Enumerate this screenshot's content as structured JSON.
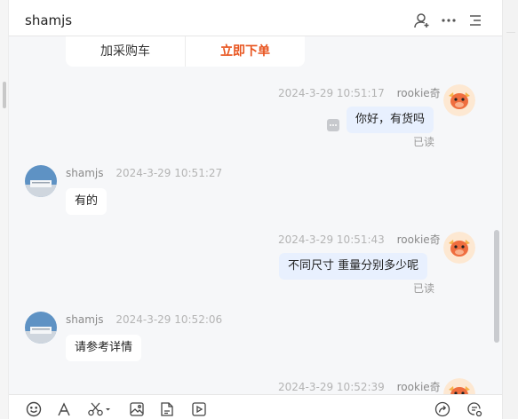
{
  "header": {
    "title": "shamjs",
    "icons": [
      "contact-icon",
      "more-icon",
      "list-icon"
    ]
  },
  "order_card": {
    "add_to_cart": "加采购车",
    "buy_now": "立即下单"
  },
  "messages": [
    {
      "sender": "rookie奇",
      "time": "2024-3-29 10:51:17",
      "text": "你好，有货吗",
      "status": "已读",
      "side": "right"
    },
    {
      "sender": "shamjs",
      "time": "2024-3-29 10:51:27",
      "text": "有的",
      "side": "left"
    },
    {
      "sender": "rookie奇",
      "time": "2024-3-29 10:51:43",
      "text": "不同尺寸  重量分别多少呢",
      "status": "已读",
      "side": "right"
    },
    {
      "sender": "shamjs",
      "time": "2024-3-29 10:52:06",
      "text": "请参考详情",
      "side": "left"
    },
    {
      "sender": "rookie奇",
      "time": "2024-3-29 10:52:39",
      "side": "right"
    }
  ],
  "toolbar": {
    "icons": [
      "emoji-icon",
      "font-icon",
      "scissors-icon",
      "image-icon",
      "file-icon",
      "video-icon",
      "share-icon",
      "quick-reply-icon"
    ]
  }
}
